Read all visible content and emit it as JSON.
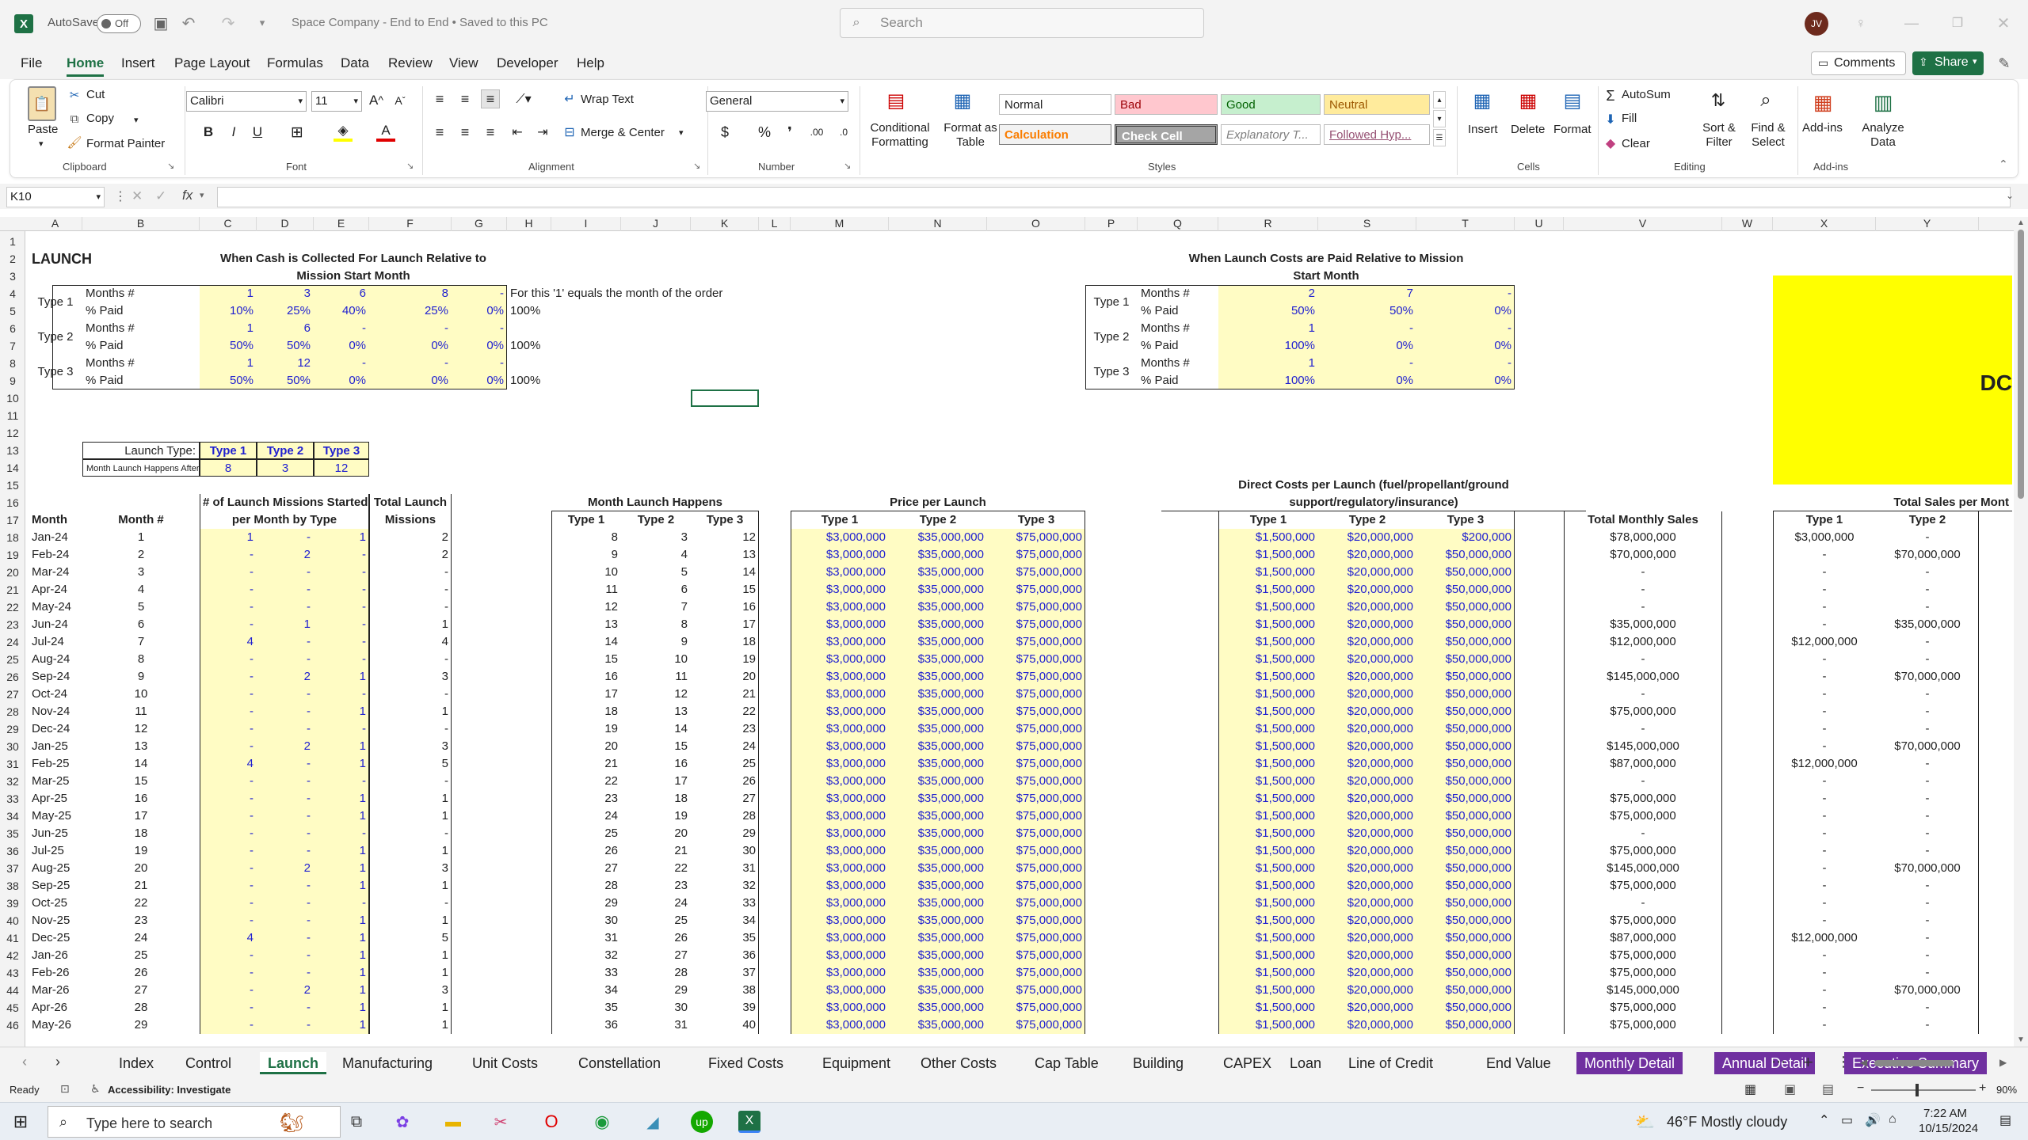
{
  "app": {
    "autosave_label": "AutoSave",
    "autosave_state": "Off",
    "document_title": "Space Company - End to End • Saved to this PC",
    "search_placeholder": "Search",
    "user_initials": "JV",
    "comments_label": "Comments",
    "share_label": "Share"
  },
  "menu": [
    "File",
    "Home",
    "Insert",
    "Page Layout",
    "Formulas",
    "Data",
    "Review",
    "View",
    "Developer",
    "Help"
  ],
  "ribbon": {
    "clipboard": {
      "paste": "Paste",
      "cut": "Cut",
      "copy": "Copy",
      "format_painter": "Format Painter",
      "group": "Clipboard"
    },
    "font": {
      "family": "Calibri",
      "size": "11",
      "group": "Font"
    },
    "alignment": {
      "wrap": "Wrap Text",
      "merge": "Merge & Center",
      "group": "Alignment"
    },
    "number": {
      "format": "General",
      "group": "Number"
    },
    "styles": {
      "conditional": "Conditional Formatting",
      "format_table": "Format as Table",
      "normal": "Normal",
      "bad": "Bad",
      "good": "Good",
      "neutral": "Neutral",
      "calculation": "Calculation",
      "check": "Check Cell",
      "explanatory": "Explanatory T...",
      "followed": "Followed Hyp...",
      "group": "Styles"
    },
    "cells": {
      "insert": "Insert",
      "delete": "Delete",
      "format": "Format",
      "group": "Cells"
    },
    "editing": {
      "autosum": "AutoSum",
      "fill": "Fill",
      "clear": "Clear",
      "sort": "Sort & Filter",
      "find": "Find & Select",
      "group": "Editing"
    },
    "addins": {
      "addins": "Add-ins",
      "analyze": "Analyze Data",
      "group": "Add-ins"
    }
  },
  "formula_bar": {
    "name_box": "K10",
    "fx": "fx",
    "formula": ""
  },
  "columns": [
    "A",
    "B",
    "C",
    "D",
    "E",
    "F",
    "G",
    "H",
    "I",
    "J",
    "K",
    "L",
    "M",
    "N",
    "O",
    "P",
    "Q",
    "R",
    "S",
    "T",
    "U",
    "V",
    "W",
    "X",
    "Y"
  ],
  "sheet": {
    "title": "LAUNCH",
    "cash_title_1": "When Cash is Collected For Launch Relative to",
    "cash_title_2": "Mission Start Month",
    "cost_title_1": "When Launch Costs are Paid Relative to Mission",
    "cost_title_2": "Start Month",
    "note": "For this '1' equals the month of the order",
    "total_100": "100%",
    "cash_table": [
      {
        "type": "Type 1",
        "months": [
          "1",
          "3",
          "6",
          "8",
          "-"
        ],
        "paid": [
          "10%",
          "25%",
          "40%",
          "25%",
          "0%"
        ]
      },
      {
        "type": "Type 2",
        "months": [
          "1",
          "6",
          "-",
          "-",
          "-"
        ],
        "paid": [
          "50%",
          "50%",
          "0%",
          "0%",
          "0%"
        ]
      },
      {
        "type": "Type 3",
        "months": [
          "1",
          "12",
          "-",
          "-",
          "-"
        ],
        "paid": [
          "50%",
          "50%",
          "0%",
          "0%",
          "0%"
        ]
      }
    ],
    "cost_table": [
      {
        "type": "Type 1",
        "months": [
          "2",
          "7",
          "-"
        ],
        "paid": [
          "50%",
          "50%",
          "0%"
        ]
      },
      {
        "type": "Type 2",
        "months": [
          "1",
          "-",
          "-"
        ],
        "paid": [
          "100%",
          "0%",
          "0%"
        ]
      },
      {
        "type": "Type 3",
        "months": [
          "1",
          "-",
          "-"
        ],
        "paid": [
          "100%",
          "0%",
          "0%"
        ]
      }
    ],
    "months_label": "Months #",
    "paid_label": "% Paid",
    "launch_type_label": "Launch Type:",
    "launch_after_label": "Month Launch Happens After Start:",
    "launch_types": [
      "Type 1",
      "Type 2",
      "Type 3"
    ],
    "launch_after": [
      "8",
      "3",
      "12"
    ],
    "yellow_text": "DC",
    "headers": {
      "month": "Month",
      "month_num": "Month #",
      "missions_1": "# of Launch Missions Started",
      "missions_2": "per Month by Type",
      "total_1": "Total Launch",
      "total_2": "Missions",
      "happens": "Month Launch Happens",
      "price": "Price per Launch",
      "direct_1": "Direct Costs per Launch (fuel/propellant/ground",
      "direct_2": "support/regulatory/insurance)",
      "monthly_sales": "Total Monthly Sales",
      "total_sales": "Total Sales per Mont",
      "t1": "Type 1",
      "t2": "Type 2",
      "t3": "Type 3"
    },
    "rows": [
      {
        "r": "18",
        "m": "Jan-24",
        "n": "1",
        "l1": "1",
        "l2": "-",
        "l3": "1",
        "tot": "2",
        "h1": "8",
        "h2": "3",
        "h3": "12",
        "p3": "$75,000,000",
        "d3": "$200,000",
        "sales": "$78,000,000",
        "s1": "$3,000,000",
        "s2": "-"
      },
      {
        "r": "19",
        "m": "Feb-24",
        "n": "2",
        "l1": "-",
        "l2": "2",
        "l3": "-",
        "tot": "2",
        "h1": "9",
        "h2": "4",
        "h3": "13",
        "p3": "$75,000,000",
        "d3": "$50,000,000",
        "sales": "$70,000,000",
        "s1": "-",
        "s2": "$70,000,000"
      },
      {
        "r": "20",
        "m": "Mar-24",
        "n": "3",
        "l1": "-",
        "l2": "-",
        "l3": "-",
        "tot": "-",
        "h1": "10",
        "h2": "5",
        "h3": "14",
        "p3": "$75,000,000",
        "d3": "$50,000,000",
        "sales": "-",
        "s1": "-",
        "s2": "-"
      },
      {
        "r": "21",
        "m": "Apr-24",
        "n": "4",
        "l1": "-",
        "l2": "-",
        "l3": "-",
        "tot": "-",
        "h1": "11",
        "h2": "6",
        "h3": "15",
        "p3": "$75,000,000",
        "d3": "$50,000,000",
        "sales": "-",
        "s1": "-",
        "s2": "-"
      },
      {
        "r": "22",
        "m": "May-24",
        "n": "5",
        "l1": "-",
        "l2": "-",
        "l3": "-",
        "tot": "-",
        "h1": "12",
        "h2": "7",
        "h3": "16",
        "p3": "$75,000,000",
        "d3": "$50,000,000",
        "sales": "-",
        "s1": "-",
        "s2": "-"
      },
      {
        "r": "23",
        "m": "Jun-24",
        "n": "6",
        "l1": "-",
        "l2": "1",
        "l3": "-",
        "tot": "1",
        "h1": "13",
        "h2": "8",
        "h3": "17",
        "p3": "$75,000,000",
        "d3": "$50,000,000",
        "sales": "$35,000,000",
        "s1": "-",
        "s2": "$35,000,000"
      },
      {
        "r": "24",
        "m": "Jul-24",
        "n": "7",
        "l1": "4",
        "l2": "-",
        "l3": "-",
        "tot": "4",
        "h1": "14",
        "h2": "9",
        "h3": "18",
        "p3": "$75,000,000",
        "d3": "$50,000,000",
        "sales": "$12,000,000",
        "s1": "$12,000,000",
        "s2": "-"
      },
      {
        "r": "25",
        "m": "Aug-24",
        "n": "8",
        "l1": "-",
        "l2": "-",
        "l3": "-",
        "tot": "-",
        "h1": "15",
        "h2": "10",
        "h3": "19",
        "p3": "$75,000,000",
        "d3": "$50,000,000",
        "sales": "-",
        "s1": "-",
        "s2": "-"
      },
      {
        "r": "26",
        "m": "Sep-24",
        "n": "9",
        "l1": "-",
        "l2": "2",
        "l3": "1",
        "tot": "3",
        "h1": "16",
        "h2": "11",
        "h3": "20",
        "p3": "$75,000,000",
        "d3": "$50,000,000",
        "sales": "$145,000,000",
        "s1": "-",
        "s2": "$70,000,000"
      },
      {
        "r": "27",
        "m": "Oct-24",
        "n": "10",
        "l1": "-",
        "l2": "-",
        "l3": "-",
        "tot": "-",
        "h1": "17",
        "h2": "12",
        "h3": "21",
        "p3": "$75,000,000",
        "d3": "$50,000,000",
        "sales": "-",
        "s1": "-",
        "s2": "-"
      },
      {
        "r": "28",
        "m": "Nov-24",
        "n": "11",
        "l1": "-",
        "l2": "-",
        "l3": "1",
        "tot": "1",
        "h1": "18",
        "h2": "13",
        "h3": "22",
        "p3": "$75,000,000",
        "d3": "$50,000,000",
        "sales": "$75,000,000",
        "s1": "-",
        "s2": "-"
      },
      {
        "r": "29",
        "m": "Dec-24",
        "n": "12",
        "l1": "-",
        "l2": "-",
        "l3": "-",
        "tot": "-",
        "h1": "19",
        "h2": "14",
        "h3": "23",
        "p3": "$75,000,000",
        "d3": "$50,000,000",
        "sales": "-",
        "s1": "-",
        "s2": "-"
      },
      {
        "r": "30",
        "m": "Jan-25",
        "n": "13",
        "l1": "-",
        "l2": "2",
        "l3": "1",
        "tot": "3",
        "h1": "20",
        "h2": "15",
        "h3": "24",
        "p3": "$75,000,000",
        "d3": "$50,000,000",
        "sales": "$145,000,000",
        "s1": "-",
        "s2": "$70,000,000"
      },
      {
        "r": "31",
        "m": "Feb-25",
        "n": "14",
        "l1": "4",
        "l2": "-",
        "l3": "1",
        "tot": "5",
        "h1": "21",
        "h2": "16",
        "h3": "25",
        "p3": "$75,000,000",
        "d3": "$50,000,000",
        "sales": "$87,000,000",
        "s1": "$12,000,000",
        "s2": "-"
      },
      {
        "r": "32",
        "m": "Mar-25",
        "n": "15",
        "l1": "-",
        "l2": "-",
        "l3": "-",
        "tot": "-",
        "h1": "22",
        "h2": "17",
        "h3": "26",
        "p3": "$75,000,000",
        "d3": "$50,000,000",
        "sales": "-",
        "s1": "-",
        "s2": "-"
      },
      {
        "r": "33",
        "m": "Apr-25",
        "n": "16",
        "l1": "-",
        "l2": "-",
        "l3": "1",
        "tot": "1",
        "h1": "23",
        "h2": "18",
        "h3": "27",
        "p3": "$75,000,000",
        "d3": "$50,000,000",
        "sales": "$75,000,000",
        "s1": "-",
        "s2": "-"
      },
      {
        "r": "34",
        "m": "May-25",
        "n": "17",
        "l1": "-",
        "l2": "-",
        "l3": "1",
        "tot": "1",
        "h1": "24",
        "h2": "19",
        "h3": "28",
        "p3": "$75,000,000",
        "d3": "$50,000,000",
        "sales": "$75,000,000",
        "s1": "-",
        "s2": "-"
      },
      {
        "r": "35",
        "m": "Jun-25",
        "n": "18",
        "l1": "-",
        "l2": "-",
        "l3": "-",
        "tot": "-",
        "h1": "25",
        "h2": "20",
        "h3": "29",
        "p3": "$75,000,000",
        "d3": "$50,000,000",
        "sales": "-",
        "s1": "-",
        "s2": "-"
      },
      {
        "r": "36",
        "m": "Jul-25",
        "n": "19",
        "l1": "-",
        "l2": "-",
        "l3": "1",
        "tot": "1",
        "h1": "26",
        "h2": "21",
        "h3": "30",
        "p3": "$75,000,000",
        "d3": "$50,000,000",
        "sales": "$75,000,000",
        "s1": "-",
        "s2": "-"
      },
      {
        "r": "37",
        "m": "Aug-25",
        "n": "20",
        "l1": "-",
        "l2": "2",
        "l3": "1",
        "tot": "3",
        "h1": "27",
        "h2": "22",
        "h3": "31",
        "p3": "$75,000,000",
        "d3": "$50,000,000",
        "sales": "$145,000,000",
        "s1": "-",
        "s2": "$70,000,000"
      },
      {
        "r": "38",
        "m": "Sep-25",
        "n": "21",
        "l1": "-",
        "l2": "-",
        "l3": "1",
        "tot": "1",
        "h1": "28",
        "h2": "23",
        "h3": "32",
        "p3": "$75,000,000",
        "d3": "$50,000,000",
        "sales": "$75,000,000",
        "s1": "-",
        "s2": "-"
      },
      {
        "r": "39",
        "m": "Oct-25",
        "n": "22",
        "l1": "-",
        "l2": "-",
        "l3": "-",
        "tot": "-",
        "h1": "29",
        "h2": "24",
        "h3": "33",
        "p3": "$75,000,000",
        "d3": "$50,000,000",
        "sales": "-",
        "s1": "-",
        "s2": "-"
      },
      {
        "r": "40",
        "m": "Nov-25",
        "n": "23",
        "l1": "-",
        "l2": "-",
        "l3": "1",
        "tot": "1",
        "h1": "30",
        "h2": "25",
        "h3": "34",
        "p3": "$75,000,000",
        "d3": "$50,000,000",
        "sales": "$75,000,000",
        "s1": "-",
        "s2": "-"
      },
      {
        "r": "41",
        "m": "Dec-25",
        "n": "24",
        "l1": "4",
        "l2": "-",
        "l3": "1",
        "tot": "5",
        "h1": "31",
        "h2": "26",
        "h3": "35",
        "p3": "$75,000,000",
        "d3": "$50,000,000",
        "sales": "$87,000,000",
        "s1": "$12,000,000",
        "s2": "-"
      },
      {
        "r": "42",
        "m": "Jan-26",
        "n": "25",
        "l1": "-",
        "l2": "-",
        "l3": "1",
        "tot": "1",
        "h1": "32",
        "h2": "27",
        "h3": "36",
        "p3": "$75,000,000",
        "d3": "$50,000,000",
        "sales": "$75,000,000",
        "s1": "-",
        "s2": "-"
      },
      {
        "r": "43",
        "m": "Feb-26",
        "n": "26",
        "l1": "-",
        "l2": "-",
        "l3": "1",
        "tot": "1",
        "h1": "33",
        "h2": "28",
        "h3": "37",
        "p3": "$75,000,000",
        "d3": "$50,000,000",
        "sales": "$75,000,000",
        "s1": "-",
        "s2": "-"
      },
      {
        "r": "44",
        "m": "Mar-26",
        "n": "27",
        "l1": "-",
        "l2": "2",
        "l3": "1",
        "tot": "3",
        "h1": "34",
        "h2": "29",
        "h3": "38",
        "p3": "$75,000,000",
        "d3": "$50,000,000",
        "sales": "$145,000,000",
        "s1": "-",
        "s2": "$70,000,000"
      },
      {
        "r": "45",
        "m": "Apr-26",
        "n": "28",
        "l1": "-",
        "l2": "-",
        "l3": "1",
        "tot": "1",
        "h1": "35",
        "h2": "30",
        "h3": "39",
        "p3": "$75,000,000",
        "d3": "$50,000,000",
        "sales": "$75,000,000",
        "s1": "-",
        "s2": "-"
      },
      {
        "r": "46",
        "m": "May-26",
        "n": "29",
        "l1": "-",
        "l2": "-",
        "l3": "1",
        "tot": "1",
        "h1": "36",
        "h2": "31",
        "h3": "40",
        "p3": "$75,000,000",
        "d3": "$50,000,000",
        "sales": "$75,000,000",
        "s1": "-",
        "s2": "-"
      }
    ],
    "price_t1": "$3,000,000",
    "price_t2": "$35,000,000",
    "direct_t1": "$1,500,000",
    "direct_t2": "$20,000,000"
  },
  "tabs": [
    "Index",
    "Control",
    "Launch",
    "Manufacturing",
    "Unit Costs",
    "Constellation",
    "Fixed Costs",
    "Equipment",
    "Other Costs",
    "Cap Table",
    "Building",
    "CAPEX",
    "Loan",
    "Line of Credit",
    "End Value",
    "Monthly Detail",
    "Annual Detail",
    "Executive Summary"
  ],
  "active_tab": "Launch",
  "status": {
    "ready": "Ready",
    "accessibility": "Accessibility: Investigate",
    "zoom": "90%"
  },
  "taskbar": {
    "search_placeholder": "Type here to search",
    "weather": "46°F  Mostly cloudy",
    "time": "7:22 AM",
    "date": "10/15/2024"
  },
  "colors": {
    "excel_green": "#1e7145",
    "input_yellow": "#fffcc4",
    "input_blue": "#1f1fd0",
    "purple_tab": "#7030a0",
    "bright_yellow": "#ffff00"
  }
}
